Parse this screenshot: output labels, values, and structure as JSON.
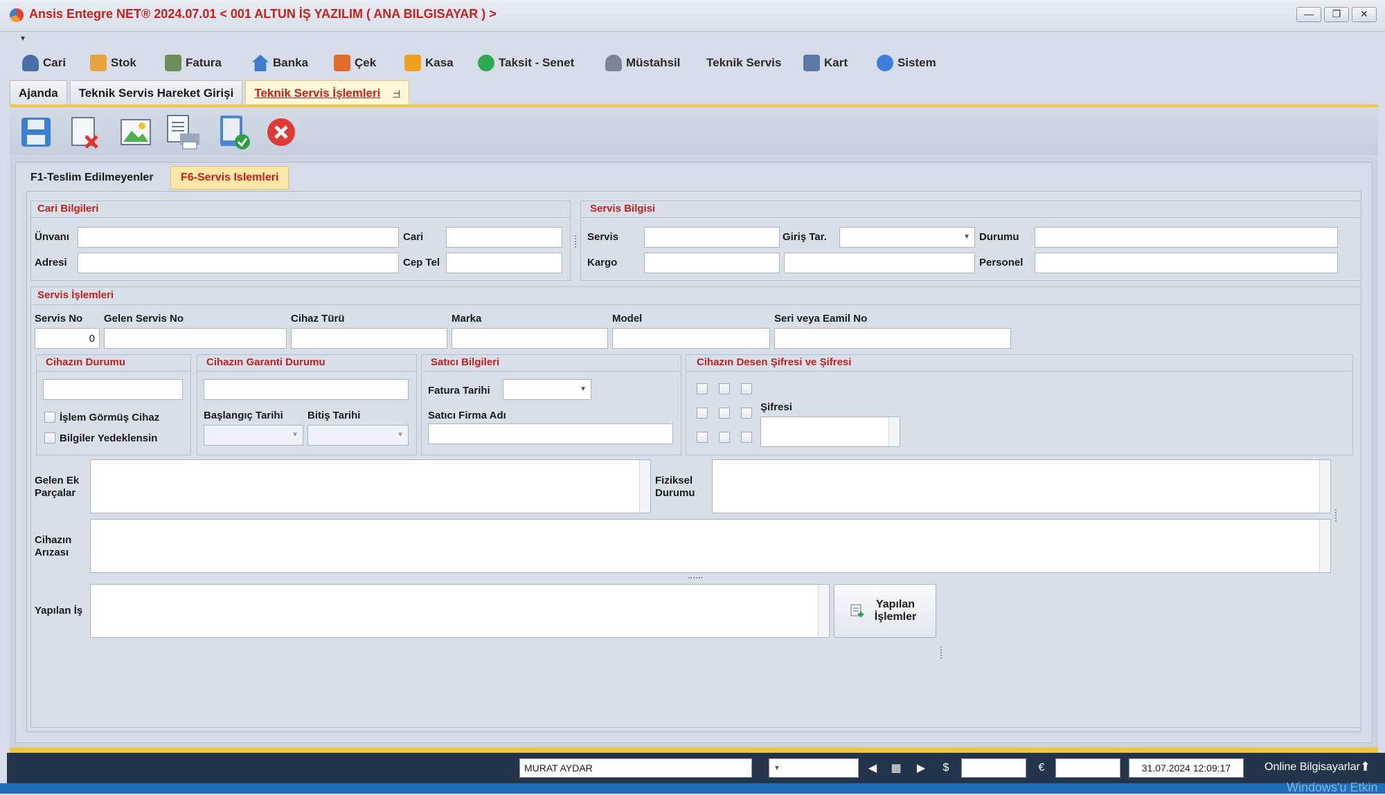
{
  "window": {
    "title": "Ansis Entegre NET® 2024.07.01  < 001 ALTUN İŞ YAZILIM ( ANA BILGISAYAR ) >",
    "buttons": {
      "minimize": "—",
      "restore": "❐",
      "close": "✕"
    }
  },
  "qat": {
    "arrow": "▾"
  },
  "menu": {
    "items": [
      {
        "label": "Cari",
        "icon": "person-icon",
        "color": "#4a6fa8"
      },
      {
        "label": "Stok",
        "icon": "boxes-icon",
        "color": "#e8a43a"
      },
      {
        "label": "Fatura",
        "icon": "invoice-icon",
        "color": "#6b8e5a"
      },
      {
        "label": "Banka",
        "icon": "bank-icon",
        "color": "#3d7cc9"
      },
      {
        "label": "Çek",
        "icon": "cheque-icon",
        "color": "#e26a2c"
      },
      {
        "label": "Kasa",
        "icon": "safe-icon",
        "color": "#f0a020"
      },
      {
        "label": "Taksit - Senet",
        "icon": "installment-icon",
        "color": "#2fa84f"
      },
      {
        "label": "Müstahsil",
        "icon": "producer-icon",
        "color": "#7a8599"
      },
      {
        "label": "Teknik Servis",
        "icon": "",
        "color": ""
      },
      {
        "label": "Kart",
        "icon": "card-icon",
        "color": "#5a78a8"
      },
      {
        "label": "Sistem",
        "icon": "gear-icon",
        "color": "#3c7dd9"
      }
    ]
  },
  "doc_tabs": [
    {
      "label": "Ajanda"
    },
    {
      "label": "Teknik Servis Hareket Girişi"
    },
    {
      "label": "Teknik Servis İşlemleri",
      "pin": "⊣"
    }
  ],
  "toolbar": {
    "buttons": [
      "save-icon",
      "delete-icon",
      "image-icon",
      "print-icon",
      "approve-icon",
      "cancel-icon"
    ]
  },
  "sub_tabs": [
    {
      "label": "F1-Teslim Edilmeyenler"
    },
    {
      "label": "F6-Servis Islemleri"
    }
  ],
  "cari": {
    "title": "Cari Bilgileri",
    "unvan_label": "Ünvanı",
    "cari_label": "Cari",
    "adres_label": "Adresi",
    "ceptel_label": "Cep Tel"
  },
  "servis_bilgisi": {
    "title": "Servis Bilgisi",
    "servis_label": "Servis",
    "giris_label": "Giriş Tar.",
    "durum_label": "Durumu",
    "kargo_label": "Kargo",
    "personel_label": "Personel"
  },
  "islemler": {
    "title": "Servis İşlemleri",
    "servis_no_label": "Servis No",
    "servis_no_value": "0",
    "gelen_servis_label": "Gelen Servis No",
    "cihaz_turu_label": "Cihaz Türü",
    "marka_label": "Marka",
    "model_label": "Model",
    "seri_label": "Seri veya Eamil No"
  },
  "cihaz_durumu": {
    "title": "Cihazın Durumu",
    "islem_gormus": "İşlem Görmüş Cihaz",
    "yedeklensin": "Bilgiler Yedeklensin"
  },
  "garanti": {
    "title": "Cihazın Garanti Durumu",
    "baslangic_label": "Başlangıç Tarihi",
    "bitis_label": "Bitiş Tarihi"
  },
  "satici": {
    "title": "Satıcı Bilgileri",
    "fatura_tarihi_label": "Fatura Tarihi",
    "firma_label": "Satıcı Firma Adı"
  },
  "desen": {
    "title": "Cihazın Desen Şifresi ve Şifresi",
    "sifre_label": "Şifresi"
  },
  "memos": {
    "gelen_ek_label": "Gelen Ek Parçalar",
    "fiziksel_label": "Fiziksel Durumu",
    "ariza_label": "Cihazın Arızası",
    "yapilan_label": "Yapılan İş",
    "yapilan_button": "Yapılan İşlemler"
  },
  "status": {
    "user": "MURAT AYDAR",
    "datetime": "31.07.2024 12:09:17",
    "online": "Online Bilgisayarlar"
  },
  "watermark": "Windows'u Etkin"
}
